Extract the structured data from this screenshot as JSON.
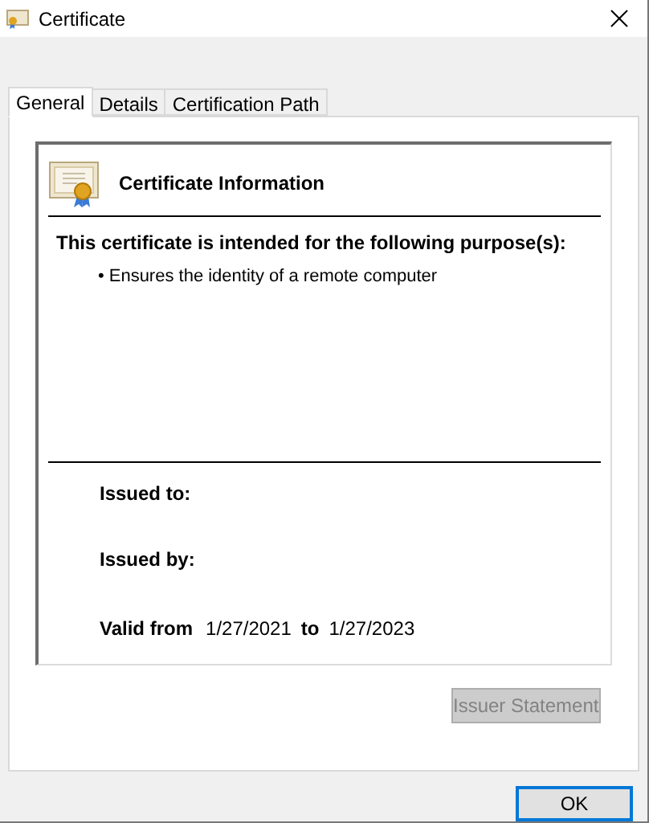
{
  "window": {
    "title": "Certificate"
  },
  "tabs": [
    {
      "label": "General",
      "selected": true
    },
    {
      "label": "Details",
      "selected": false
    },
    {
      "label": "Certification Path",
      "selected": false
    }
  ],
  "info": {
    "heading": "Certificate Information",
    "purpose_heading": "This certificate is intended for the following purpose(s):",
    "purposes": [
      "Ensures the identity of a remote computer"
    ],
    "bullet": "•",
    "issued_to_label": "Issued to:",
    "issued_by_label": "Issued by:",
    "valid_from_label": "Valid from",
    "valid_from": "1/27/2021",
    "valid_to_label": "to",
    "valid_to": "1/27/2023"
  },
  "issuer_button": {
    "label": "Issuer Statement",
    "disabled": true,
    "focused": false
  },
  "ok_button": {
    "label": "OK",
    "disabled": false,
    "focused": true
  }
}
